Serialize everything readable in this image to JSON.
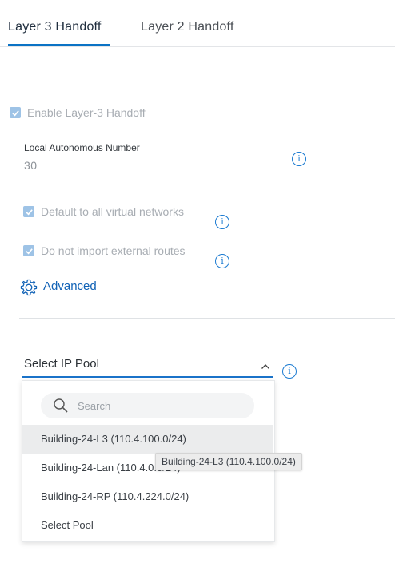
{
  "tabs": [
    {
      "label": "Layer 3 Handoff",
      "active": true
    },
    {
      "label": "Layer 2 Handoff",
      "active": false
    }
  ],
  "enable_l3": {
    "label": "Enable Layer-3 Handoff",
    "checked": true
  },
  "autonomous": {
    "label": "Local Autonomous Number",
    "value": "30"
  },
  "default_vn": {
    "label": "Default to all virtual networks",
    "checked": true
  },
  "no_import": {
    "label": "Do not import external routes",
    "checked": true
  },
  "advanced": {
    "label": "Advanced"
  },
  "ip_pool": {
    "label": "Select IP Pool",
    "search_placeholder": "Search",
    "options": [
      "Building-24-L3 (110.4.100.0/24)",
      "Building-24-Lan (110.4.0.0/24)",
      "Building-24-RP (110.4.224.0/24)",
      "Select Pool"
    ],
    "tooltip": "Building-24-L3 (110.4.100.0/24)"
  },
  "colors": {
    "accent": "#0b73c5",
    "checkbox_disabled": "#9ec3e6"
  },
  "icons": [
    "info-icon",
    "gear-icon",
    "search-icon",
    "chevron-up-icon",
    "check-icon"
  ]
}
